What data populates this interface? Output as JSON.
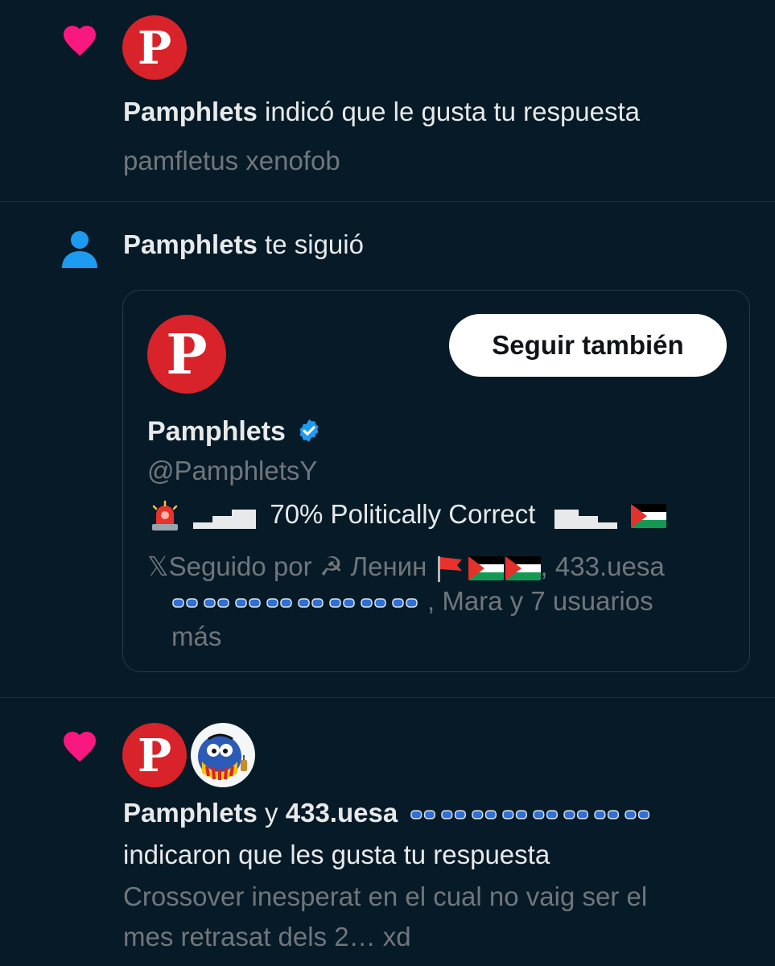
{
  "notifications": [
    {
      "type": "like",
      "icon": "heart-icon",
      "avatar_letter": "P",
      "actor": "Pamphlets",
      "action": " indicó que le gusta tu respuesta",
      "snippet": "pamfletus xenofob"
    },
    {
      "type": "follow",
      "icon": "person-icon",
      "actor": "Pamphlets",
      "action": " te siguió",
      "card": {
        "avatar_letter": "P",
        "follow_button": "Seguir también",
        "name": "Pamphlets",
        "handle": "@PamphletsY",
        "bio_text": "70% Politically Correct",
        "followed_by_prefix": "Seguido por ☭ Ленин ",
        "followed_by_sep": ", 433.uesa",
        "followed_by_rest": ", Mara y 7 usuarios",
        "followed_by_end": "más"
      }
    },
    {
      "type": "like",
      "icon": "heart-icon",
      "avatar_letter": "P",
      "actor": "Pamphlets",
      "conjunction": " y ",
      "actor2": "433.uesa",
      "action": "indicaron que les gusta tu respuesta",
      "snippet_line1": "Crossover inesperat en el cual no vaig ser el",
      "snippet_line2": "mes retrasat dels 2… xd"
    }
  ],
  "colors": {
    "background": "#061a27",
    "heart": "#f91880",
    "person_icon": "#1d9bf0",
    "verified": "#1d9bf0",
    "avatar": "#d8232a",
    "muted_text": "#71767b",
    "divider": "#22323d"
  }
}
